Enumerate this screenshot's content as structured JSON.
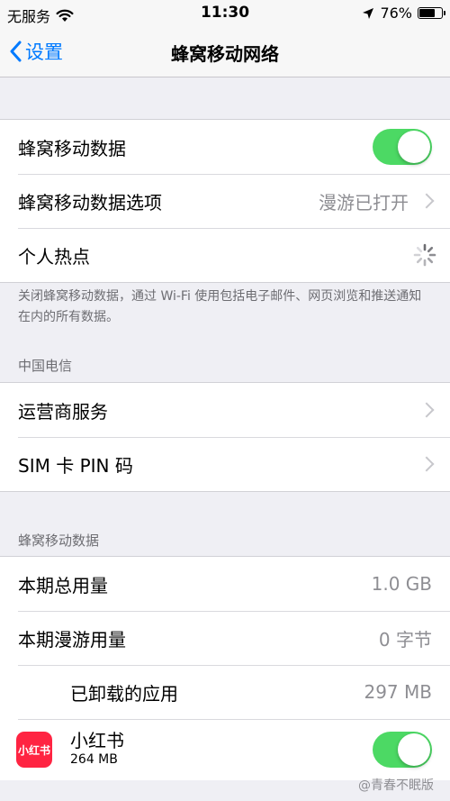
{
  "status_bar": {
    "carrier": "无服务",
    "wifi_icon": "wifi-icon",
    "time": "11:30",
    "location_icon": "location-arrow-icon",
    "battery_text": "76%",
    "battery_level": 0.76
  },
  "nav": {
    "back_label": "设置",
    "title": "蜂窝移动网络"
  },
  "group1": {
    "cellular_data_label": "蜂窝移动数据",
    "cellular_data_on": true,
    "cellular_options_label": "蜂窝移动数据选项",
    "cellular_options_value": "漫游已打开",
    "hotspot_label": "个人热点"
  },
  "footnote": "关闭蜂窝移动数据，通过 Wi-Fi 使用包括电子邮件、网页浏览和推送通知在内的所有数据。",
  "carrier_section": {
    "header": "中国电信",
    "carrier_services_label": "运营商服务",
    "sim_pin_label": "SIM 卡 PIN 码"
  },
  "usage_section": {
    "header": "蜂窝移动数据",
    "current_period_label": "本期总用量",
    "current_period_value": "1.0 GB",
    "roaming_label": "本期漫游用量",
    "roaming_value": "0 字节",
    "uninstalled_label": "已卸载的应用",
    "uninstalled_value": "297 MB"
  },
  "apps": [
    {
      "icon_text": "小红书",
      "name": "小红书",
      "size": "264 MB",
      "enabled": true
    }
  ],
  "colors": {
    "accent": "#007aff",
    "toggle_on": "#4cd964",
    "app_icon_red": "#ff2442"
  },
  "watermark": "@青春不眠版"
}
